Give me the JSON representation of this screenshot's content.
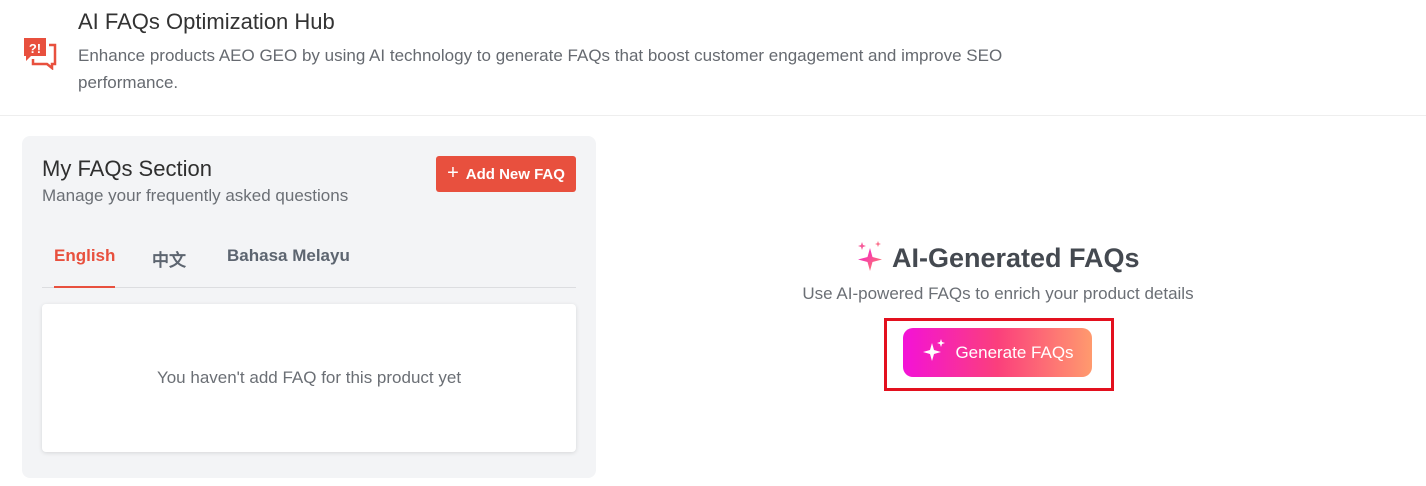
{
  "header": {
    "title": "AI FAQs Optimization Hub",
    "description": "Enhance products AEO GEO by using AI technology to generate FAQs that boost customer engagement and improve SEO performance.",
    "icon": "faq-chat-icon"
  },
  "faq_section": {
    "title": "My FAQs Section",
    "subtitle": "Manage your frequently asked questions",
    "add_button_label": "Add New FAQ",
    "tabs": [
      {
        "label": "English",
        "active": true
      },
      {
        "label": "中文",
        "active": false
      },
      {
        "label": "Bahasa Melayu",
        "active": false
      }
    ],
    "empty_message": "You haven't add FAQ for this product yet"
  },
  "ai_section": {
    "title": "AI-Generated FAQs",
    "subtitle": "Use AI-powered FAQs to enrich your product details",
    "generate_button_label": "Generate FAQs"
  },
  "colors": {
    "accent": "#e8503e",
    "highlight": "#e3101e",
    "gradient_start": "#f312d7",
    "gradient_end": "#ff9a6e"
  }
}
